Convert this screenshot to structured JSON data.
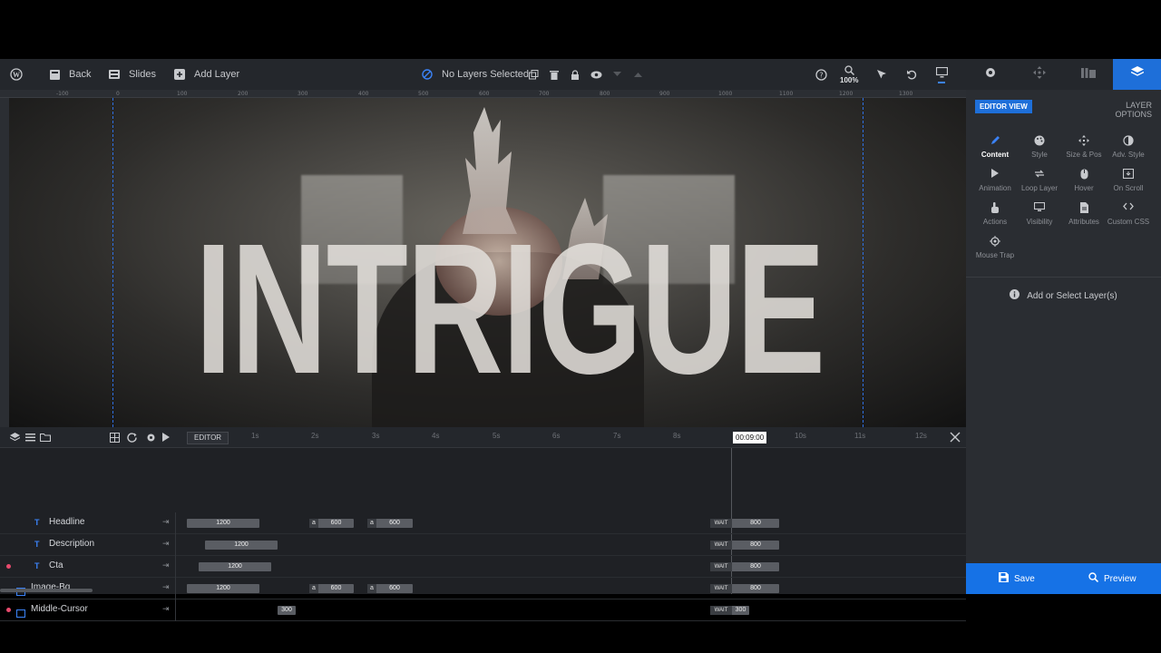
{
  "topbar": {
    "back_label": "Back",
    "slides_label": "Slides",
    "add_layer_label": "Add Layer",
    "selection_status": "No Layers Selected",
    "zoom_label": "100%"
  },
  "ruler": {
    "ticks": [
      "-100",
      "0",
      "100",
      "200",
      "300",
      "400",
      "500",
      "600",
      "700",
      "800",
      "900",
      "1000",
      "1100",
      "1200",
      "1300"
    ]
  },
  "canvas": {
    "headline_text": "INTRIGUE"
  },
  "timeline": {
    "editor_label": "EDITOR",
    "ticks": [
      "1s",
      "2s",
      "3s",
      "4s",
      "5s",
      "6s",
      "7s",
      "8s",
      "9s",
      "10s",
      "11s",
      "12s"
    ],
    "current_time": "00:09:00",
    "layers": [
      {
        "name": "Headline",
        "type_letter": "T",
        "dot": false
      },
      {
        "name": "Description",
        "type_letter": "T",
        "dot": false
      },
      {
        "name": "Cta",
        "type_letter": "T",
        "dot": true
      },
      {
        "name": "Image-Bg",
        "type_letter": "",
        "dot": false
      },
      {
        "name": "Middle-Cursor",
        "type_letter": "",
        "dot": true
      }
    ],
    "bars": {
      "headline": {
        "in": "1200",
        "a1": "600",
        "a2": "600",
        "out": "800"
      },
      "description": {
        "in": "1200",
        "out": "800"
      },
      "cta": {
        "in": "1200",
        "out": "800"
      },
      "image_bg": {
        "in": "1200",
        "a1": "600",
        "a2": "600",
        "out": "800"
      },
      "middle_cursor": {
        "in": "300",
        "out": "300"
      },
      "loop_marker": "a",
      "wait_label": "WAIT"
    }
  },
  "panel": {
    "editor_view": "EDITOR VIEW",
    "layer_options": "LAYER OPTIONS",
    "options": [
      {
        "label": "Content",
        "icon": "pencil-icon",
        "active": true
      },
      {
        "label": "Style",
        "icon": "palette-icon",
        "active": false
      },
      {
        "label": "Size & Pos",
        "icon": "move-arrows-icon",
        "active": false
      },
      {
        "label": "Adv. Style",
        "icon": "contrast-icon",
        "active": false
      },
      {
        "label": "Animation",
        "icon": "play-icon",
        "active": false
      },
      {
        "label": "Loop Layer",
        "icon": "loop-icon",
        "active": false
      },
      {
        "label": "Hover",
        "icon": "mouse-icon",
        "active": false
      },
      {
        "label": "On Scroll",
        "icon": "scroll-icon",
        "active": false
      },
      {
        "label": "Actions",
        "icon": "hand-pointer-icon",
        "active": false
      },
      {
        "label": "Visibility",
        "icon": "visibility-icon",
        "active": false
      },
      {
        "label": "Attributes",
        "icon": "document-icon",
        "active": false
      },
      {
        "label": "Custom CSS",
        "icon": "code-icon",
        "active": false
      },
      {
        "label": "Mouse Trap",
        "icon": "crosshair-icon",
        "active": false
      }
    ],
    "empty_message": "Add or Select Layer(s)",
    "save_label": "Save",
    "preview_label": "Preview"
  },
  "colors": {
    "accent": "#1e6fd9",
    "footer": "#1672e6",
    "marker": "#e84a6d"
  }
}
